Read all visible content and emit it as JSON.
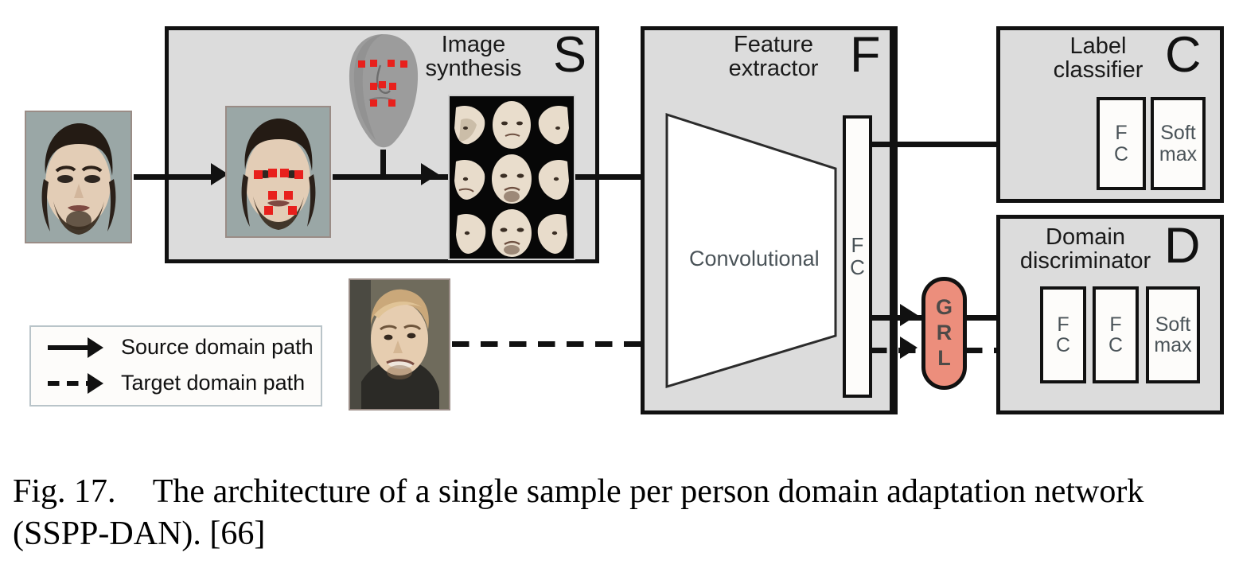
{
  "figure": {
    "caption_label": "Fig. 17.",
    "caption_text": "The architecture of a single sample per person domain adaptation network (SSPP-DAN). [66]"
  },
  "colors": {
    "module_fill": "#dcdcdc",
    "module_border": "#111111",
    "unit_fill": "#fdfcfa",
    "grl_fill": "#ec8e7c",
    "label_text": "#4a5358",
    "landmark": "#e8201c"
  },
  "modules": {
    "synthesis": {
      "title": "Image\nsynthesis",
      "letter": "S",
      "input_photo_alt": "source-domain-frontal-face",
      "model_alt": "3d-face-mesh-with-landmarks",
      "synth_grid_alt": "synthesized-multi-pose-face-grid"
    },
    "feature_extractor": {
      "title": "Feature\nextractor",
      "letter": "F",
      "conv_label": "Convolutional",
      "fc_label": "F\nC"
    },
    "label_classifier": {
      "title": "Label\nclassifier",
      "letter": "C",
      "units": [
        "F\nC",
        "Soft\nmax"
      ]
    },
    "domain_discriminator": {
      "title": "Domain\ndiscriminator",
      "letter": "D",
      "units": [
        "F\nC",
        "F\nC",
        "Soft\nmax"
      ]
    },
    "grl": {
      "label_lines": [
        "G",
        "R",
        "L"
      ]
    }
  },
  "target_input": {
    "photo_alt": "target-domain-surveillance-face"
  },
  "legend": {
    "rows": [
      {
        "style": "solid",
        "label": "Source domain path"
      },
      {
        "style": "dashed",
        "label": "Target domain path"
      }
    ]
  }
}
